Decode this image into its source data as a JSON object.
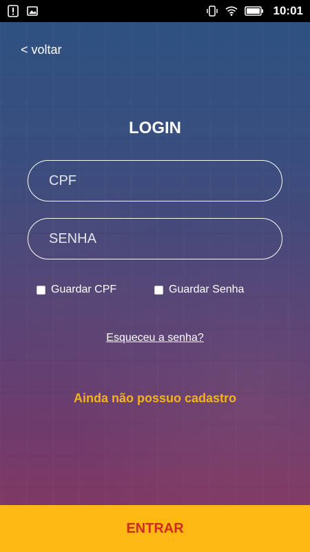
{
  "status_bar": {
    "time": "10:01",
    "icons": [
      "alert-icon",
      "image-icon",
      "vibrate-icon",
      "wifi-icon",
      "battery-icon"
    ]
  },
  "nav": {
    "back_label": "< voltar"
  },
  "login": {
    "title": "LOGIN",
    "cpf_placeholder": "CPF",
    "senha_placeholder": "SENHA",
    "remember_cpf_label": "Guardar CPF",
    "remember_senha_label": "Guardar Senha",
    "forgot_label": "Esqueceu a senha?",
    "register_label": "Ainda não possuo cadastro",
    "enter_label": "ENTRAR"
  },
  "colors": {
    "accent": "#fdb813",
    "enter_text": "#d22a1f",
    "register_text": "#f5b21e"
  }
}
